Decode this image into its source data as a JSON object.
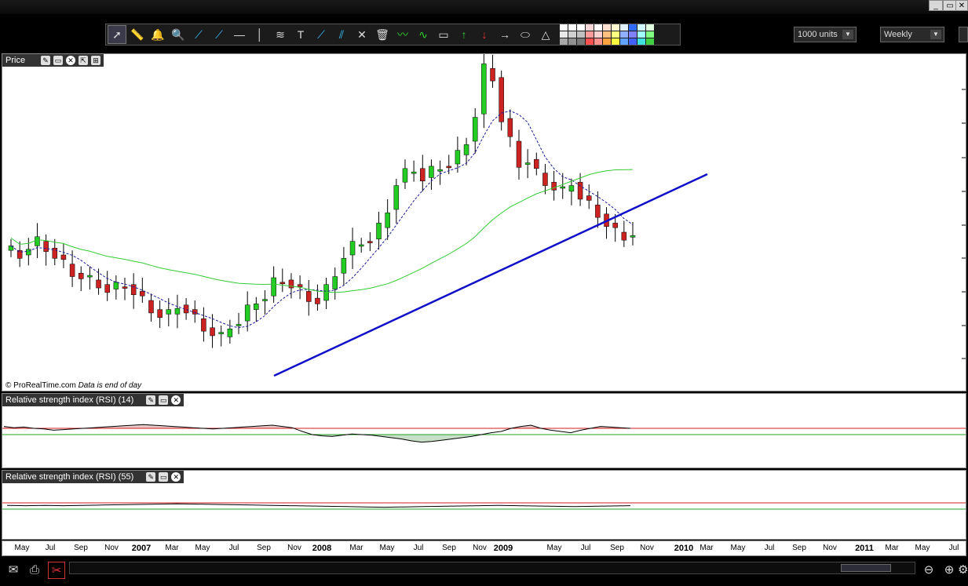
{
  "window": {
    "minimize": "_",
    "restore": "▭",
    "close": "✕"
  },
  "toolbar": {
    "tools": [
      {
        "icon": "cursor-icon",
        "glyph": "➚"
      },
      {
        "icon": "ruler-icon",
        "glyph": "📏"
      },
      {
        "icon": "alarm-icon",
        "glyph": "🔔"
      },
      {
        "icon": "zoom-icon",
        "glyph": "🔍"
      },
      {
        "icon": "line-icon",
        "glyph": "⟋"
      },
      {
        "icon": "ray-icon",
        "glyph": "⟋"
      },
      {
        "icon": "horizontal-line-icon",
        "glyph": "—"
      },
      {
        "icon": "vertical-line-icon",
        "glyph": "│"
      },
      {
        "icon": "fibonacci-icon",
        "glyph": "≋"
      },
      {
        "icon": "text-icon",
        "glyph": "T"
      },
      {
        "icon": "channel-icon",
        "glyph": "⟋"
      },
      {
        "icon": "parallel-lines-icon",
        "glyph": "⫽"
      },
      {
        "icon": "tools-icon",
        "glyph": "✕"
      },
      {
        "icon": "trash-icon",
        "glyph": "🗑"
      },
      {
        "icon": "wave-icon",
        "glyph": "〰"
      },
      {
        "icon": "gann-icon",
        "glyph": "∿"
      },
      {
        "icon": "rectangle-icon",
        "glyph": "▭"
      },
      {
        "icon": "arrow-up-icon",
        "glyph": "↑"
      },
      {
        "icon": "arrow-down-icon",
        "glyph": "↓"
      },
      {
        "icon": "arrow-right-icon",
        "glyph": "→"
      },
      {
        "icon": "ellipse-icon",
        "glyph": "⬭"
      },
      {
        "icon": "triangle-icon",
        "glyph": "△"
      }
    ],
    "swatches": [
      "#ffffff",
      "#ffffff",
      "#ffffff",
      "#f5d5d5",
      "#ffffff",
      "#ffe0d0",
      "#fffad0",
      "#e0f0ff",
      "#2f6bff",
      "#d0ffff",
      "#e0ffe0",
      "#e8e8e8",
      "#d0d0d0",
      "#c0c0c0",
      "#ff9a9a",
      "#ffd0d0",
      "#ffc080",
      "#ffff80",
      "#90b0ff",
      "#8080ff",
      "#a0ffff",
      "#80ff80",
      "#a8a8a8",
      "#909090",
      "#787878",
      "#ff5050",
      "#ff9090",
      "#ffa040",
      "#ffff40",
      "#60a0ff",
      "#4060ff",
      "#40e0e0",
      "#40d040"
    ],
    "units_select": "1000 units",
    "period_select": "Weekly"
  },
  "panels": {
    "price": {
      "title": "Price",
      "credit_brand": "© ProRealTime.com",
      "credit_note": "Data is end of day"
    },
    "rsi14": {
      "title": "Relative strength index (RSI) (14)"
    },
    "rsi55": {
      "title": "Relative strength index (RSI) (55)"
    }
  },
  "xaxis": {
    "ticks": [
      {
        "label": "May",
        "year": false
      },
      {
        "label": "Jul",
        "year": false
      },
      {
        "label": "Sep",
        "year": false
      },
      {
        "label": "Nov",
        "year": false
      },
      {
        "label": "2007",
        "year": true
      },
      {
        "label": "Mar",
        "year": false
      },
      {
        "label": "May",
        "year": false
      },
      {
        "label": "Jul",
        "year": false
      },
      {
        "label": "Sep",
        "year": false
      },
      {
        "label": "Nov",
        "year": false
      },
      {
        "label": "2008",
        "year": true
      },
      {
        "label": "Mar",
        "year": false
      },
      {
        "label": "May",
        "year": false
      },
      {
        "label": "Jul",
        "year": false
      },
      {
        "label": "Sep",
        "year": false
      },
      {
        "label": "Nov",
        "year": false
      },
      {
        "label": "2009",
        "year": true
      },
      {
        "label": "May",
        "year": false
      },
      {
        "label": "Jul",
        "year": false
      },
      {
        "label": "Sep",
        "year": false
      },
      {
        "label": "Nov",
        "year": false
      },
      {
        "label": "2010",
        "year": true
      },
      {
        "label": "Mar",
        "year": false
      },
      {
        "label": "May",
        "year": false
      },
      {
        "label": "Jul",
        "year": false
      },
      {
        "label": "Sep",
        "year": false
      },
      {
        "label": "Nov",
        "year": false
      },
      {
        "label": "2011",
        "year": true
      },
      {
        "label": "Mar",
        "year": false
      },
      {
        "label": "May",
        "year": false
      },
      {
        "label": "Jul",
        "year": false
      }
    ]
  },
  "chart_data": {
    "type": "candlestick",
    "price_path": [
      0.62,
      0.6,
      0.64,
      0.66,
      0.63,
      0.6,
      0.56,
      0.52,
      0.51,
      0.49,
      0.47,
      0.45,
      0.46,
      0.47,
      0.44,
      0.4,
      0.36,
      0.34,
      0.34,
      0.38,
      0.36,
      0.32,
      0.28,
      0.26,
      0.24,
      0.29,
      0.31,
      0.36,
      0.4,
      0.42,
      0.48,
      0.49,
      0.47,
      0.44,
      0.41,
      0.4,
      0.45,
      0.52,
      0.6,
      0.64,
      0.66,
      0.67,
      0.72,
      0.8,
      0.92,
      0.96,
      0.98,
      0.94,
      0.97,
      0.99,
      1.0,
      1.04,
      1.1,
      1.22,
      1.42,
      1.38,
      1.2,
      1.1,
      1.0,
      1.02,
      0.96,
      0.92,
      0.9,
      0.88,
      0.92,
      0.86,
      0.82,
      0.78,
      0.74,
      0.7,
      0.68,
      0.7
    ],
    "ma_fast_label": "",
    "ma_slow_label": "",
    "rsi14": [
      58,
      56,
      57,
      55,
      54,
      52,
      53,
      54,
      55,
      56,
      57,
      58,
      59,
      60,
      61,
      60,
      59,
      58,
      57,
      56,
      55,
      54,
      55,
      56,
      57,
      58,
      59,
      60,
      58,
      56,
      50,
      45,
      43,
      42,
      44,
      46,
      45,
      44,
      42,
      40,
      38,
      35,
      33,
      34,
      36,
      38,
      40,
      42,
      45,
      48,
      50,
      55,
      58,
      60,
      55,
      52,
      50,
      48,
      52,
      55,
      58,
      57,
      56,
      55
    ],
    "rsi55": [
      52,
      51,
      52,
      51,
      52,
      53,
      54,
      55,
      56,
      57,
      56,
      55,
      54,
      53,
      52,
      51,
      50,
      49,
      48,
      47,
      46,
      47,
      48,
      49,
      50,
      51,
      52,
      51,
      50,
      49,
      48,
      49,
      50,
      51
    ]
  }
}
